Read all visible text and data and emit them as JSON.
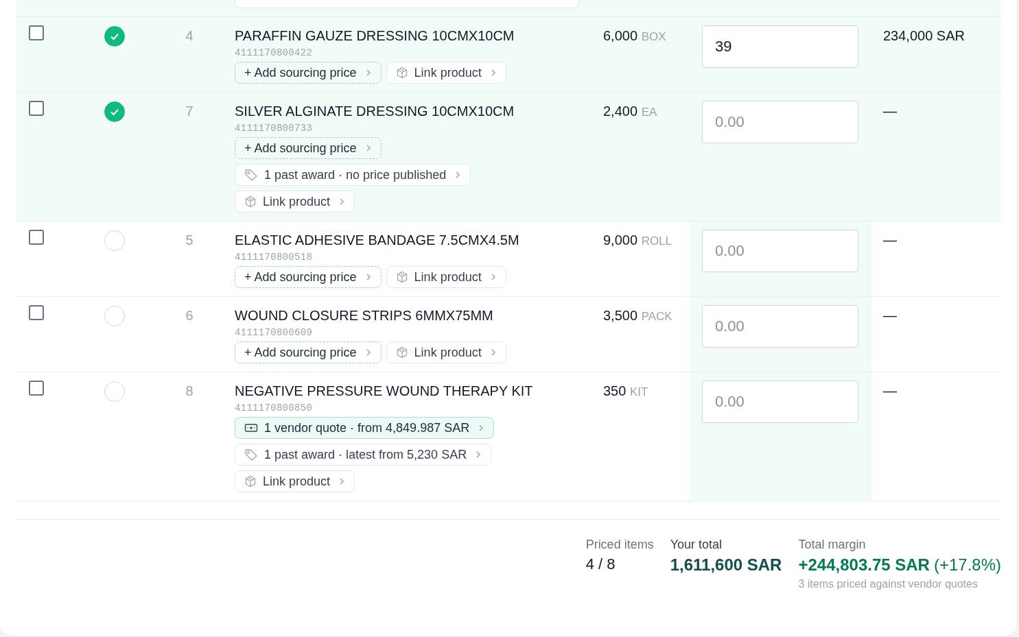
{
  "rows": [
    {
      "checked": false,
      "priced": true,
      "number": "4",
      "name": "PARAFFIN GAUZE DRESSING 10CMX10CM",
      "code": "4111170800422",
      "quantity": "6,000",
      "unit": "BOX",
      "chips": [
        {
          "kind": "add",
          "label": "+ Add sourcing price"
        },
        {
          "kind": "link",
          "label": "Link product"
        }
      ],
      "price": {
        "value": "39"
      },
      "total": "234,000 SAR"
    },
    {
      "checked": false,
      "priced": true,
      "number": "7",
      "name": "SILVER ALGINATE DRESSING 10CMX10CM",
      "code": "4111170800733",
      "quantity": "2,400",
      "unit": "EA",
      "chips": [
        {
          "kind": "add",
          "label": "+ Add sourcing price"
        },
        {
          "kind": "award",
          "label": "1 past award · no price published"
        },
        {
          "kind": "link",
          "label": "Link product"
        }
      ],
      "price": {
        "placeholder": "0.00"
      },
      "total": "—"
    },
    {
      "checked": false,
      "priced": false,
      "number": "5",
      "name": "ELASTIC ADHESIVE BANDAGE 7.5CMX4.5M",
      "code": "4111170800518",
      "quantity": "9,000",
      "unit": "ROLL",
      "chips": [
        {
          "kind": "add",
          "label": "+ Add sourcing price"
        },
        {
          "kind": "link",
          "label": "Link product"
        }
      ],
      "price": {
        "placeholder": "0.00"
      },
      "total": "—"
    },
    {
      "checked": false,
      "priced": false,
      "number": "6",
      "name": "WOUND CLOSURE STRIPS 6MMX75MM",
      "code": "4111170800609",
      "quantity": "3,500",
      "unit": "PACK",
      "chips": [
        {
          "kind": "add",
          "label": "+ Add sourcing price"
        },
        {
          "kind": "link",
          "label": "Link product"
        }
      ],
      "price": {
        "placeholder": "0.00"
      },
      "total": "—"
    },
    {
      "checked": false,
      "priced": false,
      "number": "8",
      "name": "NEGATIVE PRESSURE WOUND THERAPY KIT",
      "code": "4111170800850",
      "quantity": "350",
      "unit": "KIT",
      "chips": [
        {
          "kind": "quote",
          "label": "1 vendor quote · from 4,849.987 SAR"
        },
        {
          "kind": "award",
          "label": "1 past award · latest from 5,230 SAR"
        },
        {
          "kind": "link",
          "label": "Link product"
        }
      ],
      "price": {
        "placeholder": "0.00"
      },
      "total": "—"
    }
  ],
  "summary": {
    "priced_label": "Priced items",
    "priced_value": "4 / 8",
    "total_label": "Your total",
    "total_value": "1,611,600 SAR",
    "margin_label": "Total margin",
    "margin_value": "+244,803.75 SAR",
    "margin_percent": "(+17.8%)",
    "margin_note": "3 items priced against vendor quotes"
  }
}
